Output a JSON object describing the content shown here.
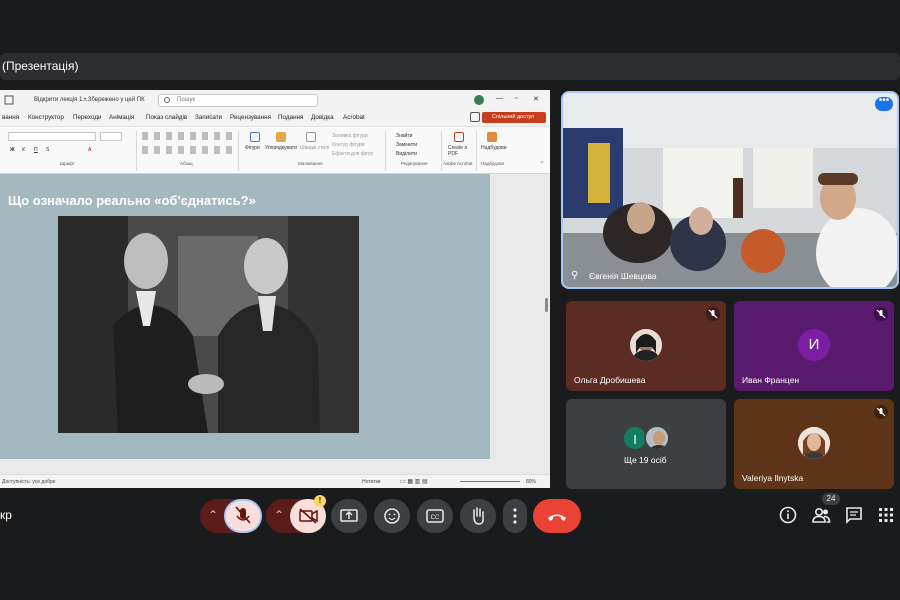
{
  "presentation_bar": {
    "label": "(Презентація)"
  },
  "ppt": {
    "filename": "Відкрити лекція 1...",
    "saved_status": "• Збережено у цей ПК",
    "search_placeholder": "Пошук",
    "menu": [
      "вання",
      "Конструктор",
      "Переходи",
      "Анімація",
      "Показ слайдів",
      "Записати",
      "Рецензування",
      "Подання",
      "Довідка",
      "Acrobat"
    ],
    "share_button": "Спільний доступ",
    "ribbon_groups": [
      "Шрифт",
      "Абзац",
      "Малювання",
      "Редагування",
      "Adobe Acrobat",
      "Надбудови"
    ],
    "ribbon_labels": {
      "shapes": "Фігури",
      "arrange": "Упорядкувати",
      "quick_styles": "Швидкі стилі",
      "shape_fill": "Заливка фігури",
      "shape_outline": "Контур фігури",
      "shape_effects": "Ефекти для фігур",
      "find": "Знайти",
      "replace": "Замінити",
      "select": "Виділити",
      "create_pdf": "Create a PDF",
      "addins": "Надбудови"
    },
    "slide_title": "Що означало реально «об'єднатись?»",
    "status_left": "Доступність: усе добре",
    "notes": "Нотатки",
    "zoom": "80%"
  },
  "participants": {
    "featured": {
      "name": "Євгенія Шевцова"
    },
    "tiles": [
      {
        "name": "Ольга Дробишева",
        "bg": "#5c2b22",
        "muted": true
      },
      {
        "name": "Иван Францен",
        "bg": "#5a1a6e",
        "avatar_letter": "И",
        "avatar_bg": "#7b1fa2",
        "muted": true
      },
      {
        "name": "Ще 19 осіб",
        "bg": "#3c4043",
        "avatar_letter": "I",
        "avatar_bg": "#137d61"
      },
      {
        "name": "Valeriya Ilnytska",
        "bg": "#5e3518",
        "muted": true
      }
    ]
  },
  "toolbar": {
    "left_text": "кр",
    "participants_count": "24",
    "camera_warning": "!"
  },
  "colors": {
    "end_call": "#ea4335",
    "accent": "#a8c7fa",
    "muted_button": "#f9dedc"
  }
}
